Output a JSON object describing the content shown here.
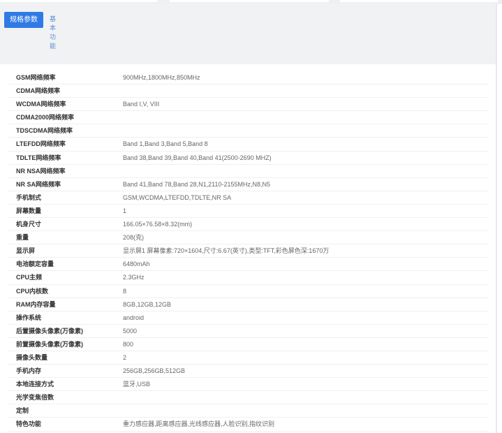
{
  "tabs": {
    "active": "规格参数",
    "other": "基本功能"
  },
  "colors": {
    "accent": "#2f7ae5"
  },
  "specs": [
    {
      "k": "GSM网络频率",
      "v": "900MHz,1800MHz,850MHz"
    },
    {
      "k": "CDMA网络频率",
      "v": ""
    },
    {
      "k": "WCDMA网络频率",
      "v": "Band I,V, VIII"
    },
    {
      "k": "CDMA2000网络频率",
      "v": ""
    },
    {
      "k": "TDSCDMA网络频率",
      "v": ""
    },
    {
      "k": "LTEFDD网络频率",
      "v": "Band 1,Band 3,Band 5,Band 8"
    },
    {
      "k": "TDLTE网络频率",
      "v": "Band 38,Band 39,Band 40,Band 41(2500-2690 MHZ)"
    },
    {
      "k": "NR NSA网络频率",
      "v": ""
    },
    {
      "k": "NR SA网络频率",
      "v": "Band 41,Band 78,Band 28,N1,2110-2155MHz,N8,N5"
    },
    {
      "k": "手机制式",
      "v": "GSM,WCDMA,LTEFDD,TDLTE,NR SA"
    },
    {
      "k": "屏幕数量",
      "v": "1"
    },
    {
      "k": "机身尺寸",
      "v": "166.05×76.58×8.32(mm)"
    },
    {
      "k": "重量",
      "v": "208(克)"
    },
    {
      "k": "显示屏",
      "v": "显示屏1 屏幕像素:720×1604,尺寸:6.67(英寸),类型:TFT,彩色屏色深:1670万"
    },
    {
      "k": "电池额定容量",
      "v": "6480mAh"
    },
    {
      "k": "CPU主频",
      "v": "2.3GHz"
    },
    {
      "k": "CPU内核数",
      "v": "8"
    },
    {
      "k": "RAM内存容量",
      "v": "8GB,12GB,12GB"
    },
    {
      "k": "操作系统",
      "v": "android"
    },
    {
      "k": "后置摄像头像素(万像素)",
      "v": "5000"
    },
    {
      "k": "前置摄像头像素(万像素)",
      "v": "800"
    },
    {
      "k": "摄像头数量",
      "v": "2"
    },
    {
      "k": "手机内存",
      "v": "256GB,256GB,512GB"
    },
    {
      "k": "本地连接方式",
      "v": "蓝牙,USB"
    },
    {
      "k": "光学变焦倍数",
      "v": ""
    },
    {
      "k": "定制",
      "v": ""
    },
    {
      "k": "特色功能",
      "v": "重力感应器,距离感应器,光线感应器,人脸识别,指纹识别"
    }
  ]
}
